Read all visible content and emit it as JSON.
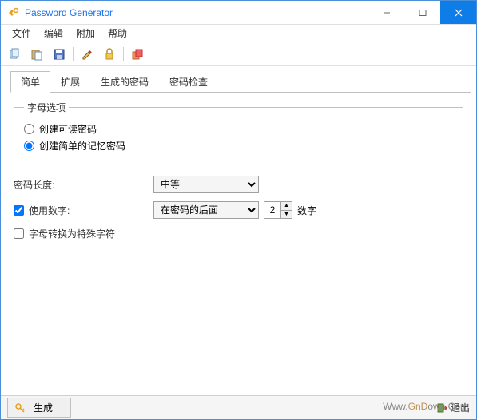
{
  "window": {
    "title": "Password Generator"
  },
  "menu": {
    "file": "文件",
    "edit": "编辑",
    "extras": "附加",
    "help": "帮助"
  },
  "tabs": {
    "simple": "简单",
    "extended": "扩展",
    "generated": "生成的密码",
    "check": "密码检查"
  },
  "letters": {
    "legend": "字母选项",
    "readable": "创建可读密码",
    "mnemonic": "创建简单的记忆密码"
  },
  "length": {
    "label": "密码长度:",
    "value": "中等"
  },
  "numbers": {
    "label": "使用数字:",
    "position": "在密码的后面",
    "count": "2",
    "unit": "数字"
  },
  "special": {
    "label": "字母转换为特殊字符"
  },
  "buttons": {
    "generate": "生成",
    "exit": "退出"
  },
  "watermark": {
    "prefix": "Www.",
    "mid": "GnD",
    "suffix": "own",
    "tld": ".Com"
  }
}
